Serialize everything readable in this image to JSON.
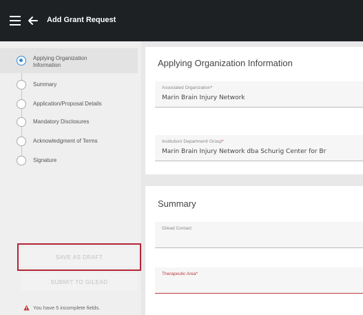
{
  "header": {
    "title": "Add Grant Request"
  },
  "sidebar": {
    "steps": [
      {
        "label": "Applying Organization Information",
        "active": true
      },
      {
        "label": "Summary"
      },
      {
        "label": "Application/Proposal Details"
      },
      {
        "label": "Mandatory Disclosures"
      },
      {
        "label": "Acknowledgment of Terms"
      },
      {
        "label": "Signature"
      }
    ],
    "save_draft_label": "SAVE AS DRAFT",
    "submit_label": "SUBMIT TO GILEAD",
    "warning_text": "You have 5 incomplete fields."
  },
  "main": {
    "org_section": {
      "title": "Applying Organization Information",
      "fields": [
        {
          "label": "Associated Organization",
          "required": "*",
          "value": "Marin Brain Injury Network"
        },
        {
          "label": "Institution/ Department/ Group",
          "required": "*",
          "value": "Marin Brain Injury Network dba Schurig Center for Br"
        }
      ]
    },
    "summary_section": {
      "title": "Summary",
      "fields": [
        {
          "label": "Gilead Contact",
          "required": "",
          "value": ""
        },
        {
          "label": "Therapeutic Area",
          "required": "*",
          "value": ""
        }
      ]
    }
  },
  "colors": {
    "topbar": "#1e2124",
    "accent": "#2f8ad8",
    "highlight": "#b42335",
    "error": "#c2383b"
  }
}
